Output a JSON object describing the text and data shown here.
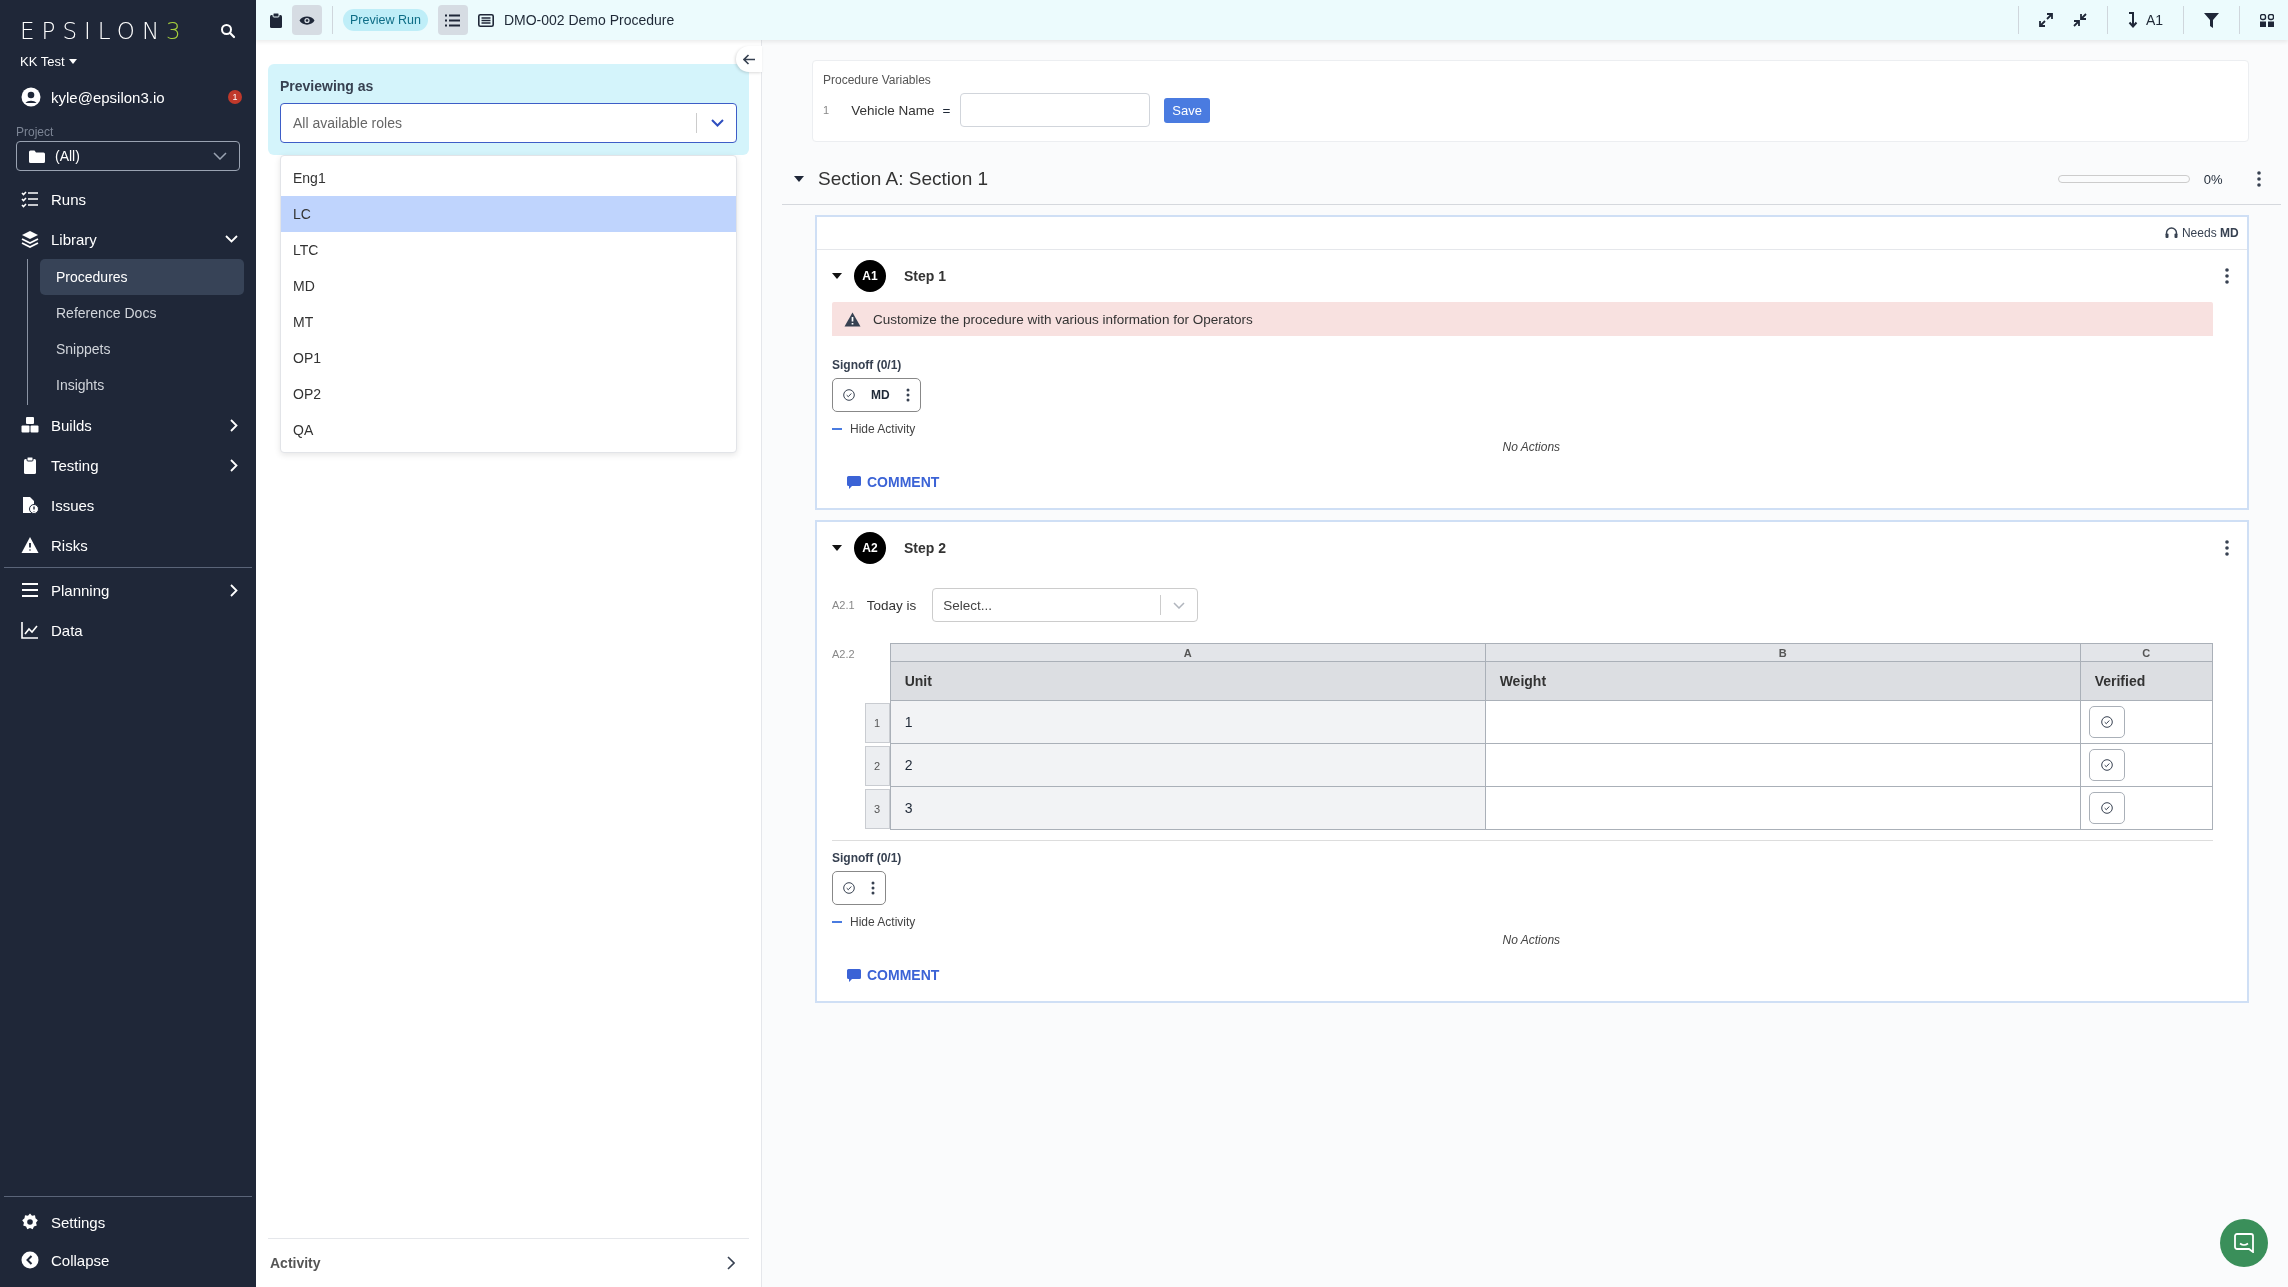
{
  "sidebar": {
    "logo": "EPSILON3",
    "workspace": "KK Test",
    "user": {
      "email": "kyle@epsilon3.io",
      "badge": "1"
    },
    "project": {
      "label": "Project",
      "value": "(All)"
    },
    "items": [
      {
        "label": "Runs",
        "selected": false
      },
      {
        "label": "Library",
        "selected": false,
        "expanded": true,
        "children": [
          {
            "label": "Procedures",
            "selected": true
          },
          {
            "label": "Reference Docs",
            "selected": false
          },
          {
            "label": "Snippets",
            "selected": false
          },
          {
            "label": "Insights",
            "selected": false
          }
        ]
      },
      {
        "label": "Builds",
        "selected": false,
        "expanded": false
      },
      {
        "label": "Testing",
        "selected": false,
        "expanded": false
      },
      {
        "label": "Issues",
        "selected": false
      },
      {
        "label": "Risks",
        "selected": false
      },
      {
        "label": "Planning",
        "selected": false,
        "expanded": false
      },
      {
        "label": "Data",
        "selected": false
      }
    ],
    "footer": [
      {
        "label": "Settings"
      },
      {
        "label": "Collapse"
      }
    ]
  },
  "toolbar": {
    "preview_on": true,
    "outline_on": true,
    "badge": "Preview Run",
    "title": "DMO-002 Demo Procedure",
    "jump_target": "A1"
  },
  "preview_panel": {
    "label": "Previewing as",
    "select": {
      "placeholder": "All available roles"
    },
    "options": [
      {
        "label": "Eng1",
        "selected": false
      },
      {
        "label": "LC",
        "selected": true
      },
      {
        "label": "LTC",
        "selected": false
      },
      {
        "label": "MD",
        "selected": false
      },
      {
        "label": "MT",
        "selected": false
      },
      {
        "label": "OP1",
        "selected": false
      },
      {
        "label": "OP2",
        "selected": false
      },
      {
        "label": "QA",
        "selected": false
      }
    ],
    "activity": "Activity"
  },
  "variables": {
    "title": "Procedure Variables",
    "rows": [
      {
        "index": "1",
        "name": "Vehicle Name",
        "operator": "=",
        "button": "Save"
      }
    ]
  },
  "section": {
    "title": "Section A: Section 1",
    "level": 0,
    "percent": "0%",
    "needs": "Needs",
    "needs_role": "MD",
    "steps": [
      {
        "badge": "A1",
        "title": "Step 1",
        "blocks": [
          {
            "kind": "warning",
            "text": "Customize the procedure with various information for Operators"
          }
        ],
        "signoff": {
          "label": "Signoff (0/1)",
          "role": "MD"
        },
        "activity": "Hide Activity",
        "no_actions": "No Actions",
        "comment": "COMMENT"
      },
      {
        "badge": "A2",
        "title": "Step 2",
        "blocks": [
          {
            "kind": "select",
            "index": "A2.1",
            "label": "Today is",
            "placeholder": "Select..."
          },
          {
            "kind": "table",
            "index": "A2.2",
            "letters": [
              "A",
              "B",
              "C"
            ],
            "columns": [
              "Unit",
              "Weight",
              "Verified"
            ],
            "rows": [
              {
                "number": "1",
                "unit": "1"
              },
              {
                "number": "2",
                "unit": "2"
              },
              {
                "number": "3",
                "unit": "3"
              }
            ]
          }
        ],
        "signoff": {
          "label": "Signoff (0/1)"
        },
        "activity": "Hide Activity",
        "no_actions": "No Actions",
        "comment": "COMMENT"
      }
    ]
  }
}
